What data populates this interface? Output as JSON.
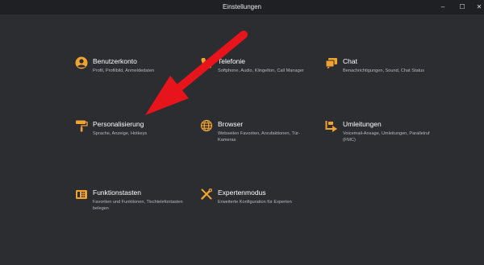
{
  "window": {
    "title": "Einstellungen",
    "min_glyph": "–",
    "max_glyph": "☐",
    "close_glyph": "✕"
  },
  "accent_color": "#f0a330",
  "tiles": [
    {
      "icon": "user-icon",
      "label": "Benutzerkonto",
      "desc": "Profil, Profilbild, Anmeldedaten"
    },
    {
      "icon": "phone-icon",
      "label": "Telefonie",
      "desc": "Softphone, Audio, Klingelton, Call Manager"
    },
    {
      "icon": "chat-icon",
      "label": "Chat",
      "desc": "Benachrichtigungen, Sound, Chat Status"
    },
    {
      "icon": "paint-roller-icon",
      "label": "Personalisierung",
      "desc": "Sprache, Anzeige, Hotkeys"
    },
    {
      "icon": "globe-icon",
      "label": "Browser",
      "desc": "Webseiten Favoriten, Anrufaktionen, Tür-Kameras"
    },
    {
      "icon": "redirect-icon",
      "label": "Umleitungen",
      "desc": "Voicemail-Ansage, Umleitungen, Parallelruf (FMC)"
    },
    {
      "icon": "telephone-keys-icon",
      "label": "Funktionstasten",
      "desc": "Favoriten und Funktionen, Tischtelefontasten belegen"
    },
    {
      "icon": "tools-icon",
      "label": "Expertenmodus",
      "desc": "Erweiterte Konfiguration für Experten"
    }
  ],
  "annotation": {
    "arrow_color": "#e8141b"
  }
}
